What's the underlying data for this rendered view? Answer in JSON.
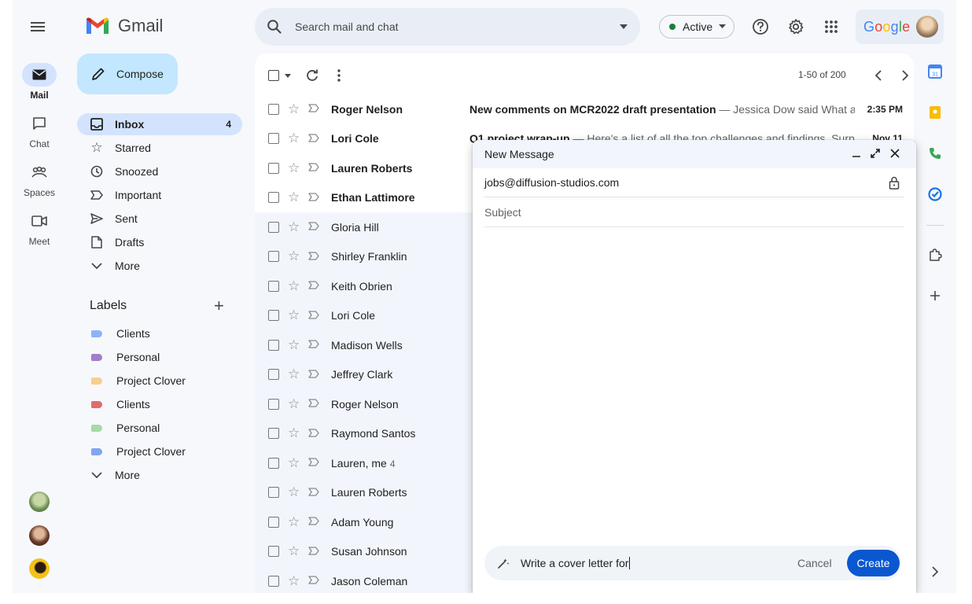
{
  "rail": {
    "items": [
      {
        "label": "Mail",
        "icon": "mail-icon"
      },
      {
        "label": "Chat",
        "icon": "chat-icon"
      },
      {
        "label": "Spaces",
        "icon": "spaces-icon"
      },
      {
        "label": "Meet",
        "icon": "meet-icon"
      }
    ]
  },
  "header": {
    "app_name": "Gmail",
    "search_placeholder": "Search mail and chat",
    "status": "Active",
    "account_word": "Google"
  },
  "sidebar": {
    "compose_label": "Compose",
    "items": [
      {
        "label": "Inbox",
        "count": "4",
        "icon": "inbox-icon"
      },
      {
        "label": "Starred",
        "icon": "star-icon"
      },
      {
        "label": "Snoozed",
        "icon": "clock-icon"
      },
      {
        "label": "Important",
        "icon": "important-icon"
      },
      {
        "label": "Sent",
        "icon": "send-icon"
      },
      {
        "label": "Drafts",
        "icon": "draft-icon"
      },
      {
        "label": "More",
        "icon": "chevron-down-icon"
      }
    ],
    "labels_title": "Labels",
    "labels": [
      {
        "name": "Clients",
        "color": "#8ab4f8"
      },
      {
        "name": "Personal",
        "color": "#a17fc9"
      },
      {
        "name": "Project Clover",
        "color": "#f6cf8f"
      },
      {
        "name": "Clients",
        "color": "#e06b6b"
      },
      {
        "name": "Personal",
        "color": "#a8d8a8"
      },
      {
        "name": "Project Clover",
        "color": "#7fa6f0"
      }
    ],
    "labels_more": "More"
  },
  "mail_list": {
    "pager": "1-50 of 200",
    "rows": [
      {
        "sender": "Roger Nelson",
        "count": "",
        "subject": "New comments on MCR2022 draft presentation",
        "snippet": " — Jessica Dow said What a...",
        "date": "2:35 PM",
        "unread": true
      },
      {
        "sender": "Lori Cole",
        "count": "",
        "subject": "Q1 project wrap-up",
        "snippet": " — Here's a list of all the top challenges and findings. Surp...",
        "date": "Nov 11",
        "unread": true
      },
      {
        "sender": "Lauren Roberts",
        "count": "",
        "subject": "",
        "snippet": "",
        "date": "",
        "unread": true
      },
      {
        "sender": "Ethan Lattimore",
        "count": "",
        "subject": "",
        "snippet": "",
        "date": "",
        "unread": true
      },
      {
        "sender": "Gloria Hill",
        "count": "",
        "subject": "",
        "snippet": "",
        "date": "",
        "unread": false
      },
      {
        "sender": "Shirley Franklin",
        "count": "",
        "subject": "",
        "snippet": "",
        "date": "",
        "unread": false
      },
      {
        "sender": "Keith Obrien",
        "count": "",
        "subject": "",
        "snippet": "",
        "date": "",
        "unread": false
      },
      {
        "sender": "Lori Cole",
        "count": "",
        "subject": "",
        "snippet": "",
        "date": "",
        "unread": false
      },
      {
        "sender": "Madison Wells",
        "count": "",
        "subject": "",
        "snippet": "",
        "date": "",
        "unread": false
      },
      {
        "sender": "Jeffrey Clark",
        "count": "",
        "subject": "",
        "snippet": "",
        "date": "",
        "unread": false
      },
      {
        "sender": "Roger Nelson",
        "count": "",
        "subject": "",
        "snippet": "",
        "date": "",
        "unread": false
      },
      {
        "sender": "Raymond Santos",
        "count": "",
        "subject": "",
        "snippet": "",
        "date": "",
        "unread": false
      },
      {
        "sender": "Lauren, me",
        "count": "4",
        "subject": "",
        "snippet": "",
        "date": "",
        "unread": false
      },
      {
        "sender": "Lauren Roberts",
        "count": "",
        "subject": "",
        "snippet": "",
        "date": "",
        "unread": false
      },
      {
        "sender": "Adam Young",
        "count": "",
        "subject": "",
        "snippet": "",
        "date": "",
        "unread": false
      },
      {
        "sender": "Susan Johnson",
        "count": "",
        "subject": "",
        "snippet": "",
        "date": "",
        "unread": false
      },
      {
        "sender": "Jason Coleman",
        "count": "",
        "subject": "",
        "snippet": "",
        "date": "",
        "unread": false
      }
    ]
  },
  "compose_window": {
    "title": "New Message",
    "to": "jobs@diffusion-studios.com",
    "subject_placeholder": "Subject",
    "ai_prompt": "Write a cover letter for",
    "cancel_label": "Cancel",
    "create_label": "Create"
  },
  "colors": {
    "accent": "#0b57d0",
    "compose_bg": "#c2e7ff",
    "active_nav": "#d3e3fd",
    "status_green": "#188038"
  }
}
